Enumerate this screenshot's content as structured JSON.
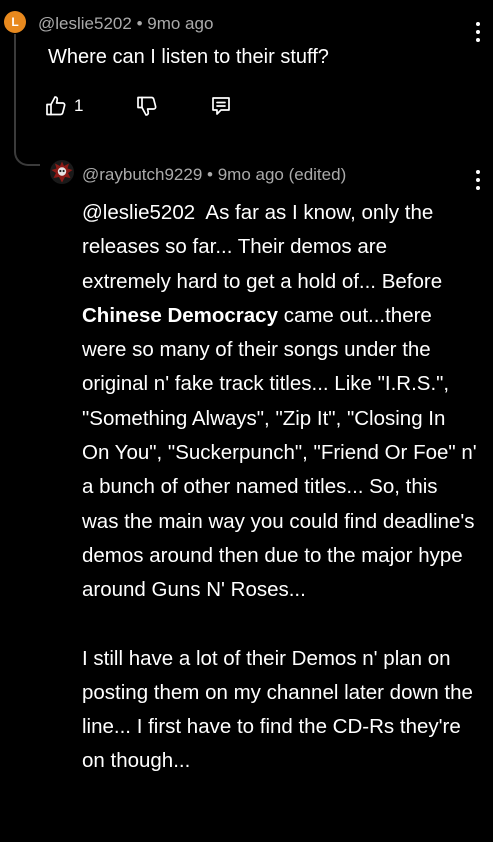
{
  "comment": {
    "avatar_letter": "L",
    "avatar_color": "#e8891e",
    "handle": "@leslie5202",
    "separator": "•",
    "time": "9mo ago",
    "text": "Where can I listen to their stuff?",
    "like_count": "1",
    "icons": [
      "thumbs-up-icon",
      "thumbs-down-icon",
      "reply-icon",
      "more-vertical-icon"
    ]
  },
  "reply": {
    "handle": "@raybutch9229",
    "separator": "•",
    "time": "9mo ago (edited)",
    "mention": "@leslie5202",
    "text_1": "As far as I know, only the releases so far... Their demos are extremely hard to get a hold of... Before",
    "bold": "Chinese Democracy",
    "text_2": "came out...there were so many of their songs under the original n' fake track titles... Like \"I.R.S.\", \"Something Always\", \"Zip It\", \"Closing In On You\", \"Suckerpunch\", \"Friend Or Foe\" n' a bunch of other named titles... So, this was the main way you could find deadline's demos around then due to the major hype around Guns N' Roses...",
    "paragraph_2": "I still have a lot of their Demos n' plan on posting them on my channel later down the line... I first have to find the CD-Rs they're on though..."
  }
}
